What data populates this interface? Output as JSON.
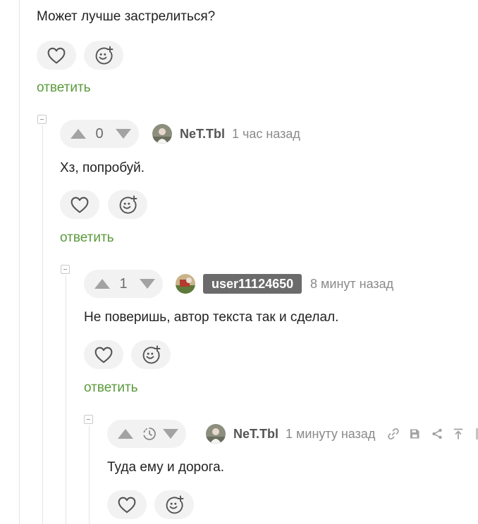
{
  "comment_0": {
    "text": "Может лучше застрелиться?",
    "reply_label": "ответить"
  },
  "comment_1": {
    "votes": "0",
    "author": "NeT.Tbl",
    "time": "1 час назад",
    "text": "Хз, попробуй.",
    "reply_label": "ответить"
  },
  "comment_2": {
    "votes": "1",
    "author": "user11124650",
    "time": "8 минут назад",
    "text": "Не поверишь, автор текста так и сделал.",
    "reply_label": "ответить"
  },
  "comment_3": {
    "votes_pending": true,
    "author": "NeT.Tbl",
    "time": "1 минуту назад",
    "text": "Туда ему и дорога.",
    "tools": [
      "link-icon",
      "save-icon",
      "share-icon",
      "scroll-up-icon"
    ]
  },
  "icons": {
    "like": "heart-icon",
    "reaction": "add-emoji-icon",
    "vote_up": "triangle-up-icon",
    "vote_down": "triangle-down-icon"
  },
  "colors": {
    "reply_link": "#5b9a3c",
    "vote_arrow": "#a3a3a3",
    "author_badge": "#6b6b6b",
    "button_background": "#f2f2f3"
  }
}
